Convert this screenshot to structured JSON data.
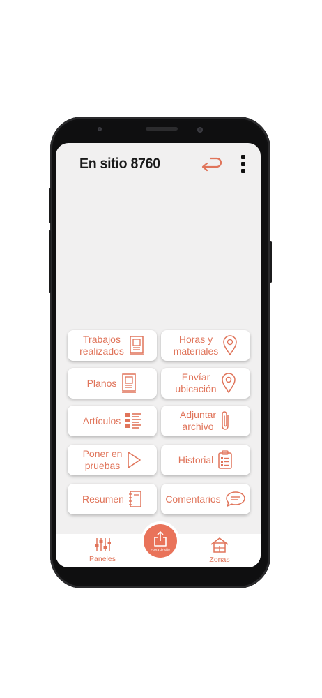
{
  "header": {
    "title": "En sitio 8760"
  },
  "tiles": [
    {
      "line1": "Trabajos",
      "line2": "realizados",
      "icon": "worksheet-icon"
    },
    {
      "line1": "Horas y",
      "line2": "materiales",
      "icon": "map-pin-icon"
    },
    {
      "line1": "Planos",
      "line2": "",
      "icon": "blueprint-icon"
    },
    {
      "line1": "Envíar",
      "line2": "ubicación",
      "icon": "map-pin-icon"
    },
    {
      "line1": "Artículos",
      "line2": "",
      "icon": "list-icon"
    },
    {
      "line1": "Adjuntar",
      "line2": "archivo",
      "icon": "paperclip-icon"
    },
    {
      "line1": "Poner en",
      "line2": "pruebas",
      "icon": "play-icon"
    },
    {
      "line1": "Historial",
      "line2": "",
      "icon": "clipboard-icon"
    },
    {
      "line1": "Resumen",
      "line2": "",
      "icon": "notebook-icon"
    },
    {
      "line1": "Comentarios",
      "line2": "",
      "icon": "chat-bubble-icon"
    }
  ],
  "bottom_nav": {
    "left_label": "Paneles",
    "center_label": "Fuera de sitio",
    "right_label": "Zonas"
  },
  "colors": {
    "accent": "#e0745a",
    "fab": "#e9735a",
    "screen_bg": "#f1f0f0"
  }
}
